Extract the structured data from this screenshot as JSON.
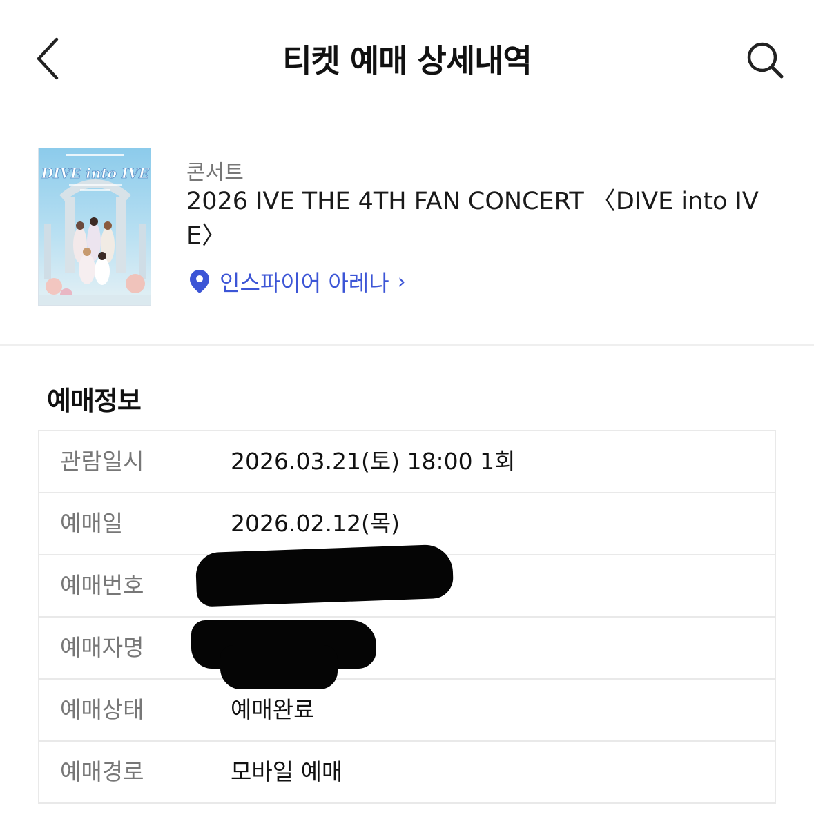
{
  "header": {
    "title": "티켓 예매 상세내역",
    "back_icon": "chevron-left-icon",
    "search_icon": "search-icon"
  },
  "event": {
    "category": "콘서트",
    "title": "2026 IVE THE 4TH FAN CONCERT 〈DIVE into IVE〉",
    "venue": "인스파이어 아레나",
    "venue_chevron": "›",
    "venue_icon": "location-pin-icon",
    "poster": {
      "headline": "DIVE into IVE",
      "background_color": "#a9d6ef"
    }
  },
  "booking_info": {
    "section_title": "예매정보",
    "rows": [
      {
        "label": "관람일시",
        "value": "2026.03.21(토) 18:00 1회"
      },
      {
        "label": "예매일",
        "value": "2026.02.12(목)"
      },
      {
        "label": "예매번호",
        "value": ""
      },
      {
        "label": "예매자명",
        "value": ""
      },
      {
        "label": "예매상태",
        "value": "예매완료"
      },
      {
        "label": "예매경로",
        "value": "모바일 예매"
      }
    ]
  },
  "colors": {
    "accent": "#3c55d6",
    "label_gray": "#777777",
    "border": "#e9e9e9"
  }
}
